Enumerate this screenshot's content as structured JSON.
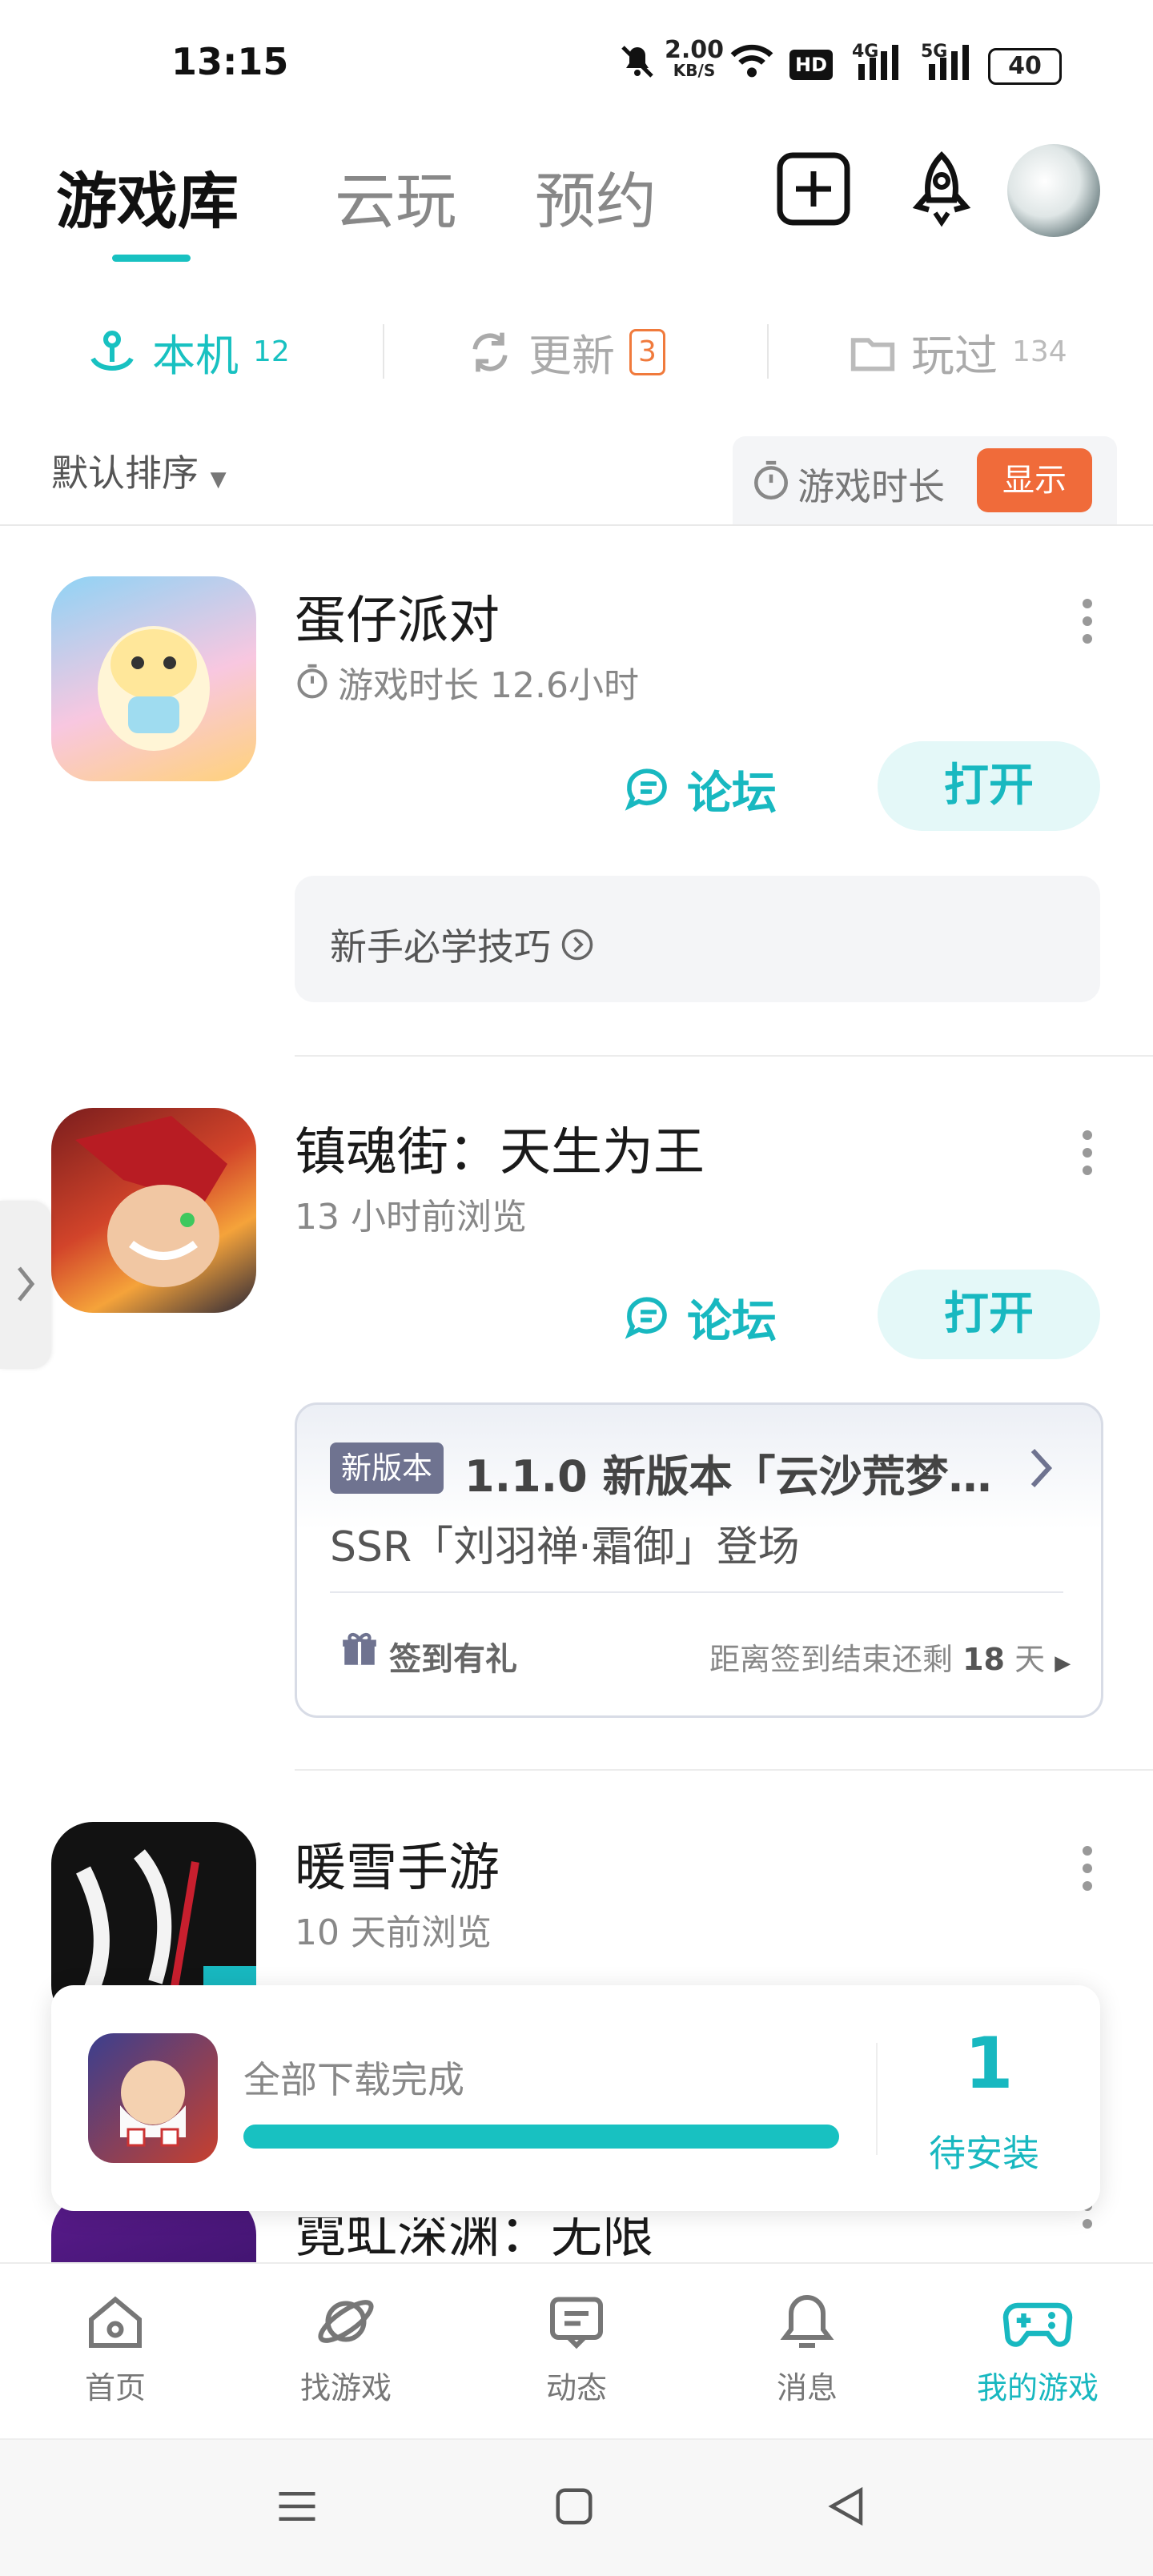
{
  "status_bar": {
    "time": "13:15",
    "net_speed": "2.00",
    "net_unit": "KB/S",
    "hd": "HD",
    "sig1": "4G",
    "sig2": "5G",
    "battery": "40"
  },
  "top_tabs": [
    "游戏库",
    "云玩",
    "预约"
  ],
  "sub_tabs": [
    {
      "label": "本机",
      "count": "12"
    },
    {
      "label": "更新",
      "count": "3"
    },
    {
      "label": "玩过",
      "count": "134"
    }
  ],
  "sort": {
    "label": "默认排序"
  },
  "duration_toggle": {
    "label": "游戏时长",
    "button": "显示"
  },
  "games": [
    {
      "title": "蛋仔派对",
      "subtitle": "游戏时长 12.6小时",
      "forum": "论坛",
      "open": "打开"
    },
    {
      "title": "镇魂街：天生为王",
      "subtitle": "13 小时前浏览",
      "forum": "论坛",
      "open": "打开"
    },
    {
      "title": "暖雪手游",
      "subtitle": "10 天前浏览"
    },
    {
      "title": "霓虹深渊：无限"
    }
  ],
  "tip": {
    "text": "新手必学技巧"
  },
  "news_card": {
    "tag": "新版本",
    "title": "1.1.0 新版本「云沙荒梦…",
    "line2": "SSR「刘羽禅·霜御」登场",
    "checkin": "签到有礼",
    "remain_prefix": "距离签到结束还剩",
    "remain_days": "18",
    "remain_suffix": "天"
  },
  "download": {
    "text": "全部下载完成",
    "progress": 1.0,
    "count": "1",
    "pending": "待安装"
  },
  "bottom_nav": [
    "首页",
    "找游戏",
    "动态",
    "消息",
    "我的游戏"
  ],
  "colors": {
    "accent": "#18c1c1",
    "orange": "#f06b3a"
  }
}
